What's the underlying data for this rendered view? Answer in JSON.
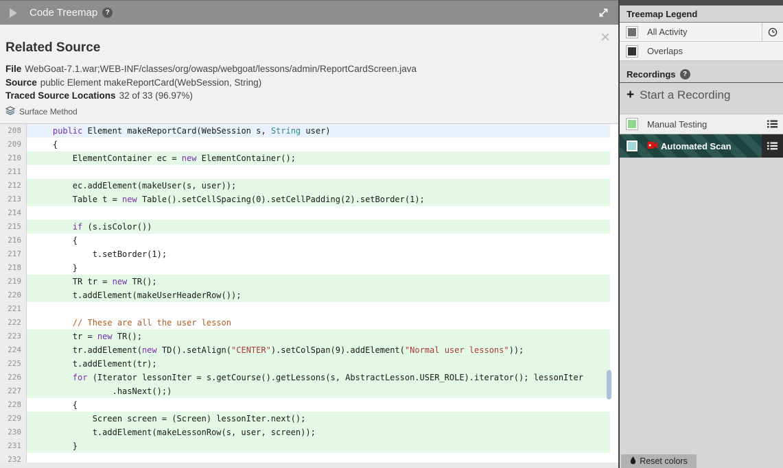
{
  "header": {
    "title": "Code Treemap",
    "help": "?"
  },
  "panel": {
    "title": "Related Source",
    "close": "×",
    "meta": [
      {
        "label": "File",
        "value": "WebGoat-7.1.war;WEB-INF/classes/org/owasp/webgoat/lessons/admin/ReportCardScreen.java"
      },
      {
        "label": "Source",
        "value": "public Element makeReportCard(WebSession, String)"
      },
      {
        "label": "Traced Source Locations",
        "value": "32 of 33 (96.97%)"
      }
    ],
    "badge": {
      "icon": "layers",
      "label": "Surface Method"
    }
  },
  "code": {
    "syntax_colors": {
      "keyword": "#7a2eb0",
      "type": "#2e8b8b",
      "string": "#a93a38",
      "comment": "#b05c20",
      "plain": "#1a1a1a"
    },
    "highlight_colors": {
      "traced": "#e4f8e6",
      "selected": "#e8f1fc"
    },
    "lines": [
      {
        "n": 208,
        "hl": "selected",
        "t": [
          [
            "    ",
            ""
          ],
          [
            "public",
            "k"
          ],
          [
            " Element makeReportCard(WebSession s, ",
            ""
          ],
          [
            "String",
            "t"
          ],
          [
            " user)",
            ""
          ]
        ]
      },
      {
        "n": 209,
        "hl": "",
        "t": [
          [
            "    {",
            ""
          ]
        ]
      },
      {
        "n": 210,
        "hl": "traced",
        "t": [
          [
            "        ElementContainer ec = ",
            ""
          ],
          [
            "new",
            "k"
          ],
          [
            " ElementContainer();",
            ""
          ]
        ]
      },
      {
        "n": 211,
        "hl": "",
        "t": []
      },
      {
        "n": 212,
        "hl": "traced",
        "t": [
          [
            "        ec.addElement(makeUser(s, user));",
            ""
          ]
        ]
      },
      {
        "n": 213,
        "hl": "traced",
        "t": [
          [
            "        Table t = ",
            ""
          ],
          [
            "new",
            "k"
          ],
          [
            " Table().setCellSpacing(0).setCellPadding(2).setBorder(1);",
            ""
          ]
        ]
      },
      {
        "n": 214,
        "hl": "",
        "t": []
      },
      {
        "n": 215,
        "hl": "traced",
        "t": [
          [
            "        ",
            ""
          ],
          [
            "if",
            "k"
          ],
          [
            " (s.isColor())",
            ""
          ]
        ]
      },
      {
        "n": 216,
        "hl": "",
        "t": [
          [
            "        {",
            ""
          ]
        ]
      },
      {
        "n": 217,
        "hl": "",
        "t": [
          [
            "            t.setBorder(1);",
            ""
          ]
        ]
      },
      {
        "n": 218,
        "hl": "",
        "t": [
          [
            "        }",
            ""
          ]
        ]
      },
      {
        "n": 219,
        "hl": "traced",
        "t": [
          [
            "        TR tr = ",
            ""
          ],
          [
            "new",
            "k"
          ],
          [
            " TR();",
            ""
          ]
        ]
      },
      {
        "n": 220,
        "hl": "traced",
        "t": [
          [
            "        t.addElement(makeUserHeaderRow());",
            ""
          ]
        ]
      },
      {
        "n": 221,
        "hl": "",
        "t": []
      },
      {
        "n": 222,
        "hl": "",
        "t": [
          [
            "        ",
            ""
          ],
          [
            "// These are all the user lesson",
            "c"
          ]
        ]
      },
      {
        "n": 223,
        "hl": "traced",
        "t": [
          [
            "        tr = ",
            ""
          ],
          [
            "new",
            "k"
          ],
          [
            " TR();",
            ""
          ]
        ]
      },
      {
        "n": 224,
        "hl": "traced",
        "t": [
          [
            "        tr.addElement(",
            ""
          ],
          [
            "new",
            "k"
          ],
          [
            " TD().setAlign(",
            ""
          ],
          [
            "\"CENTER\"",
            "s"
          ],
          [
            ").setColSpan(9).addElement(",
            ""
          ],
          [
            "\"Normal user lessons\"",
            "s"
          ],
          [
            "));",
            ""
          ]
        ]
      },
      {
        "n": 225,
        "hl": "traced",
        "t": [
          [
            "        t.addElement(tr);",
            ""
          ]
        ]
      },
      {
        "n": 226,
        "hl": "traced",
        "t": [
          [
            "        ",
            ""
          ],
          [
            "for",
            "k"
          ],
          [
            " (Iterator lessonIter = s.getCourse().getLessons(s, AbstractLesson.USER_ROLE).iterator(); lessonIter",
            ""
          ]
        ]
      },
      {
        "n": 227,
        "hl": "traced",
        "t": [
          [
            "                .hasNext();)",
            ""
          ]
        ]
      },
      {
        "n": 228,
        "hl": "",
        "t": [
          [
            "        {",
            ""
          ]
        ]
      },
      {
        "n": 229,
        "hl": "traced",
        "t": [
          [
            "            Screen screen = (Screen) lessonIter.next();",
            ""
          ]
        ]
      },
      {
        "n": 230,
        "hl": "traced",
        "t": [
          [
            "            t.addElement(makeLessonRow(s, user, screen));",
            ""
          ]
        ]
      },
      {
        "n": 231,
        "hl": "traced",
        "t": [
          [
            "        }",
            ""
          ]
        ]
      },
      {
        "n": 232,
        "hl": "",
        "t": []
      }
    ]
  },
  "sidebar": {
    "legend": {
      "title": "Treemap Legend",
      "items": [
        {
          "label": "All Activity",
          "swatch": "#6e6e6e",
          "icon": "clock"
        },
        {
          "label": "Overlaps",
          "swatch": "#333333"
        }
      ]
    },
    "recordings": {
      "title": "Recordings",
      "help": "?",
      "plus": "+",
      "start_label": "Start a Recording",
      "items": [
        {
          "label": "Manual Testing",
          "swatch": "#8dd98d",
          "selected": false,
          "icon": "menu"
        },
        {
          "label": "Automated Scan",
          "swatch": "#9fd8d6",
          "selected": true,
          "icon": "menu",
          "recording_icon": "camcorder"
        }
      ]
    },
    "reset": {
      "icon": "droplet",
      "label": "Reset colors"
    }
  }
}
